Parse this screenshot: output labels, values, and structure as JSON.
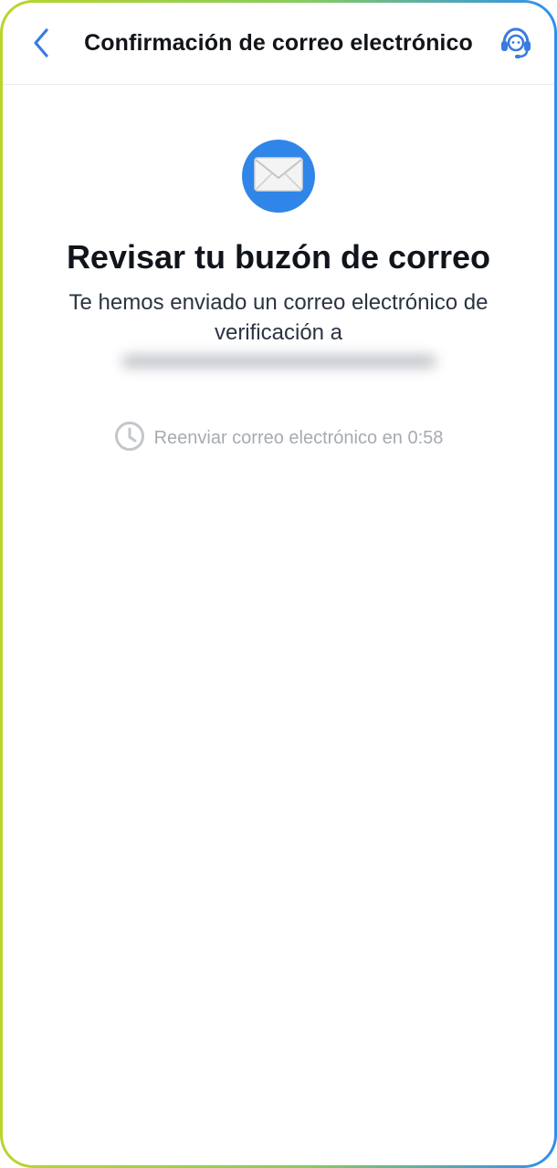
{
  "header": {
    "title": "Confirmación de correo electrónico",
    "back_icon": "chevron-left-icon",
    "support_icon": "headset-support-icon",
    "accent_color": "#3a7be0"
  },
  "main": {
    "mail_icon": "envelope-icon",
    "mail_icon_bg": "#2f86e8",
    "heading": "Revisar tu buzón de correo",
    "subtext_line1": "Te hemos enviado un correo electrónico de",
    "subtext_line2": "verificación a",
    "resend_icon": "clock-icon",
    "resend_label": "Reenviar correo electrónico en 0:58"
  }
}
